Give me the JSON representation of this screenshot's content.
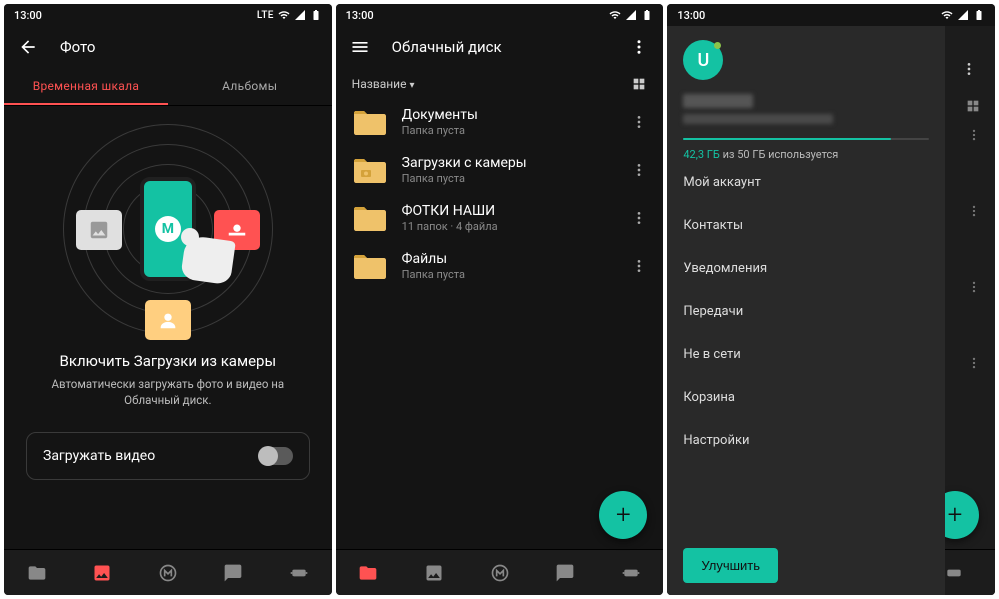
{
  "status": {
    "time": "13:00",
    "lte": "LTE"
  },
  "screen1": {
    "title": "Фото",
    "tabs": {
      "timeline": "Временная шкала",
      "albums": "Альбомы"
    },
    "cu_title": "Включить Загрузки из камеры",
    "cu_sub": "Автоматически загружать фото и видео на Облачный диск.",
    "toggle_label": "Загружать видео",
    "phone_letter": "M"
  },
  "screen2": {
    "title": "Облачный диск",
    "sort_label": "Название",
    "folders": [
      {
        "name": "Документы",
        "sub": "Папка пуста",
        "type": "plain"
      },
      {
        "name": "Загрузки с камеры",
        "sub": "Папка пуста",
        "type": "camera"
      },
      {
        "name": "ФОТКИ НАШИ",
        "sub": "11 папок · 4 файла",
        "type": "plain"
      },
      {
        "name": "Файлы",
        "sub": "Папка пуста",
        "type": "plain"
      }
    ],
    "fab": "+"
  },
  "screen3": {
    "avatar_letter": "U",
    "usage_used": "42,3 ГБ",
    "usage_rest": " из 50 ГБ используется",
    "usage_percent": 84.6,
    "items": [
      "Мой аккаунт",
      "Контакты",
      "Уведомления",
      "Передачи",
      "Не в сети",
      "Корзина",
      "Настройки"
    ],
    "upgrade": "Улучшить",
    "fab": "+"
  },
  "colors": {
    "accent": "#14c2a3",
    "danger": "#ff5252"
  }
}
